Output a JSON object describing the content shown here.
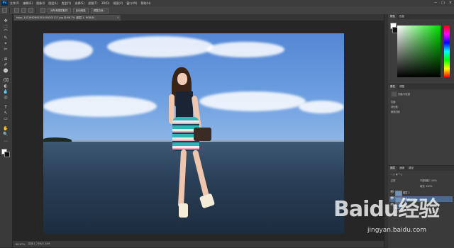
{
  "app": {
    "logo": "Ps"
  },
  "menu": [
    "文件(F)",
    "编辑(E)",
    "图像(I)",
    "图层(L)",
    "类型(Y)",
    "选择(S)",
    "滤镜(T)",
    "3D(D)",
    "视图(V)",
    "窗口(W)",
    "帮助(H)"
  ],
  "window_controls": [
    "−",
    "□",
    "×"
  ],
  "options_bar": {
    "btn1": "对所有图层取样",
    "btn2": "自动增强",
    "btn3": "调整边缘..."
  },
  "document": {
    "tab_label": "hbpc_1421662692501450201117.jpg @ 66.7% (图层 1, RGB/8)",
    "close": "×"
  },
  "tools": [
    "✥",
    "⬚",
    "⌒",
    "✎",
    "⌖",
    "✂",
    "⊕",
    "✐",
    "⬤",
    "⌫",
    "◐",
    "💧",
    "◎",
    "T",
    "↖",
    "▭",
    "✋",
    "🔍",
    "⋯"
  ],
  "status": {
    "zoom": "66.67%",
    "doc": "文档:1.23M/2.25M"
  },
  "color_panel": {
    "tabs": [
      "颜色",
      "色板"
    ]
  },
  "adjustments_panel": {
    "tabs": [
      "属性",
      "调整"
    ],
    "title": "亮度/对比度",
    "rows": [
      "亮度:",
      "对比度:",
      "使用旧版"
    ]
  },
  "layers_panel": {
    "tabs": [
      "图层",
      "通道",
      "路径"
    ],
    "blend": "正常",
    "opacity": "不透明度: 100%",
    "fill": "填充: 100%",
    "layers": [
      {
        "name": "图层 1",
        "selected": false
      },
      {
        "name": "图层 2",
        "selected": true
      },
      {
        "name": "背景",
        "selected": false
      }
    ]
  },
  "watermark": {
    "logo": "Baidu经验",
    "url": "jingyan.baidu.com"
  }
}
